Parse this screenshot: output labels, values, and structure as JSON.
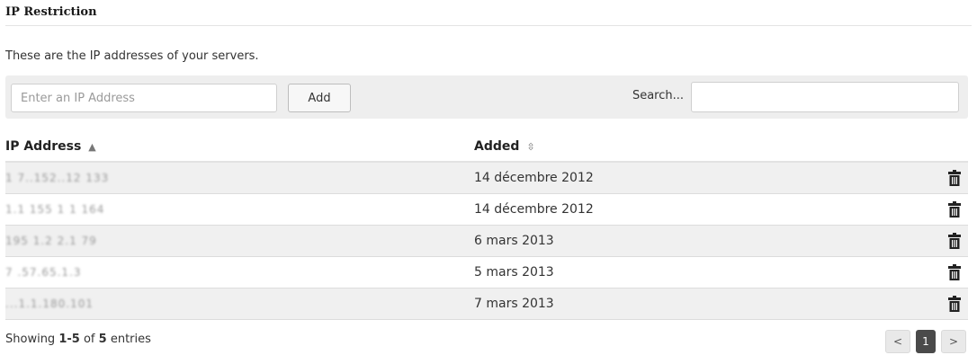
{
  "section": {
    "title": "IP Restriction"
  },
  "intro": "These are the IP addresses of your servers.",
  "toolbar": {
    "ip_placeholder": "Enter an IP Address",
    "add_label": "Add",
    "search_label": "Search...",
    "search_value": ""
  },
  "table": {
    "columns": [
      "IP Address",
      "Added"
    ],
    "sort_asc": "▲",
    "sort_both": "⇳",
    "rows": [
      {
        "ip": "1 7..152..12 133",
        "added": "14 décembre 2012"
      },
      {
        "ip": "1.1 155 1 1 164",
        "added": "14 décembre 2012"
      },
      {
        "ip": "195 1.2 2.1 79",
        "added": "6 mars 2013"
      },
      {
        "ip": "7 .57.65.1.3",
        "added": "5 mars 2013"
      },
      {
        "ip": "...1.1.180.101",
        "added": "7 mars 2013"
      }
    ]
  },
  "footer": {
    "showing": "Showing",
    "range": "1-5",
    "of": "of",
    "total": "5",
    "entries": "entries"
  },
  "pagination": {
    "prev": "<",
    "current": "1",
    "next": ">"
  },
  "icons": {
    "delete": "trash-icon"
  }
}
